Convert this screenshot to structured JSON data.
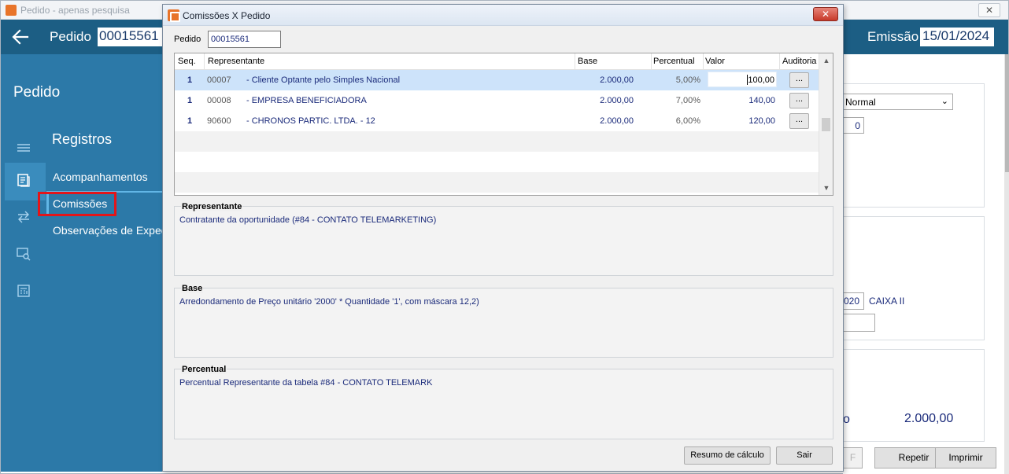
{
  "background_window": {
    "title": "Pedido - apenas pesquisa",
    "close_label": "✕",
    "header": {
      "pedido_label": "Pedido",
      "pedido_value": "00015561",
      "emissao_label": "Emissão",
      "emissao_value": "15/01/2024"
    },
    "left_panel": {
      "title": "Pedido",
      "section": "Registros",
      "items": [
        {
          "label": "Acompanhamentos"
        },
        {
          "label": "Comissões"
        },
        {
          "label": "Observações de Expedi"
        }
      ],
      "icons": [
        "menu-icon",
        "document-icon",
        "transfer-icon",
        "screen-search-icon",
        "calendar-icon"
      ]
    },
    "right_content": {
      "select_value": "Normal",
      "number_value": "0",
      "code_value": "020",
      "code_label": "CAIXA II",
      "total_prefix": "o",
      "total_value": "2.000,00",
      "buttons": {
        "f": "F",
        "repetir": "Repetir",
        "imprimir": "Imprimir"
      }
    }
  },
  "dialog": {
    "title": "Comissões X Pedido",
    "close_label": "✕",
    "pedido_label": "Pedido",
    "pedido_value": "00015561",
    "grid": {
      "columns": [
        "Seq.",
        "Representante",
        "Base",
        "Percentual",
        "Valor",
        "Auditoria"
      ],
      "rows": [
        {
          "seq": "1",
          "code": "00007",
          "representante": "- Cliente Optante pelo Simples Nacional",
          "base": "2.000,00",
          "percentual": "5,00%",
          "valor": "100,00",
          "auditoria": "..."
        },
        {
          "seq": "1",
          "code": "00008",
          "representante": "- EMPRESA BENEFICIADORA",
          "base": "2.000,00",
          "percentual": "7,00%",
          "valor": "140,00",
          "auditoria": "..."
        },
        {
          "seq": "1",
          "code": "90600",
          "representante": "- CHRONOS PARTIC. LTDA. - 12",
          "base": "2.000,00",
          "percentual": "6,00%",
          "valor": "120,00",
          "auditoria": "..."
        }
      ]
    },
    "representante_box": {
      "title": "Representante",
      "text": "Contratante da oportunidade (#84 - CONTATO TELEMARKETING)"
    },
    "base_box": {
      "title": "Base",
      "text": "Arredondamento de Preço unitário '2000' * Quantidade '1', com máscara 12,2)"
    },
    "percentual_box": {
      "title": "Percentual",
      "text": "Percentual Representante da tabela #84 - CONTATO TELEMARK"
    },
    "buttons": {
      "resumo": "Resumo de cálculo",
      "sair": "Sair"
    }
  }
}
